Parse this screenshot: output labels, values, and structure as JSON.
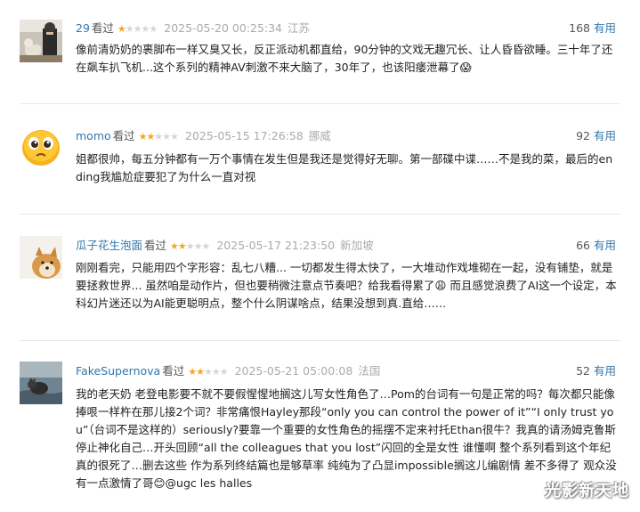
{
  "comments": [
    {
      "user": "29",
      "status": "看过",
      "rating": 1,
      "time": "2025-05-20 00:25:34",
      "location": "江苏",
      "votes": "168",
      "useful_label": "有用",
      "avatar_icon": "man-with-dog-photo-icon",
      "text": "像前清奶奶的裹脚布一样又臭又长，反正派动机都直给，90分钟的文戏无趣冗长、让人昏昏欲睡。三十年了还在飙车扒飞机...这个系列的精神AV刺激不来大脑了，30年了，也该阳痿泄幕了😱"
    },
    {
      "user": "momo",
      "status": "看过",
      "rating": 2,
      "time": "2025-05-15 17:26:58",
      "location": "挪威",
      "votes": "92",
      "useful_label": "有用",
      "avatar_icon": "crying-emoji-face-icon",
      "text": "姐都很帅，每五分钟都有一万个事情在发生但是我还是觉得好无聊。第一部碟中谍……不是我的菜，最后的ending我尴尬症要犯了为什么一直对视"
    },
    {
      "user": "瓜子花生泡面",
      "status": "看过",
      "rating": 2,
      "time": "2025-05-17 21:23:50",
      "location": "新加坡",
      "votes": "66",
      "useful_label": "有用",
      "avatar_icon": "shiba-dog-photo-icon",
      "text": "刚刚看完，只能用四个字形容：乱七八糟... 一切都发生得太快了，一大堆动作戏堆砌在一起，没有铺垫，就是要拯救世界... 虽然咱是动作片，但也要稍微注意点节奏吧？给我看得累了😩 而且感觉浪费了AI这一个设定，本科幻片迷还以为AI能更聪明点，整个什么阴谋啥点，结果没想到真.直给……"
    },
    {
      "user": "FakeSupernova",
      "status": "看过",
      "rating": 2,
      "time": "2025-05-21 05:00:08",
      "location": "法国",
      "votes": "52",
      "useful_label": "有用",
      "avatar_icon": "cat-in-water-photo-icon",
      "text": "我的老天奶 老登电影要不就不要假惺惺地搁这儿写女性角色了…Pom的台词有一句是正常的吗？每次都只能像捧哏一样杵在那儿接2个词？非常痛恨Hayley那段“only you can control the power of it”“I only trust you”（台词不是这样的）seriously?要靠一个重要的女性角色的摇摆不定来衬托Ethan很牛？我真的请汤姆克鲁斯停止神化自己…开头回顾“all the colleagues that you lost”闪回的全是女性 谁懂啊 整个系列看到这个年纪真的很死了…删去这些 作为系列终结篇也是够草率 纯纯为了凸显impossible搁这儿编剧情 差不多得了 观众没有一点激情了哥😊@ugc les halles"
    }
  ],
  "watermark": "光影新天地"
}
